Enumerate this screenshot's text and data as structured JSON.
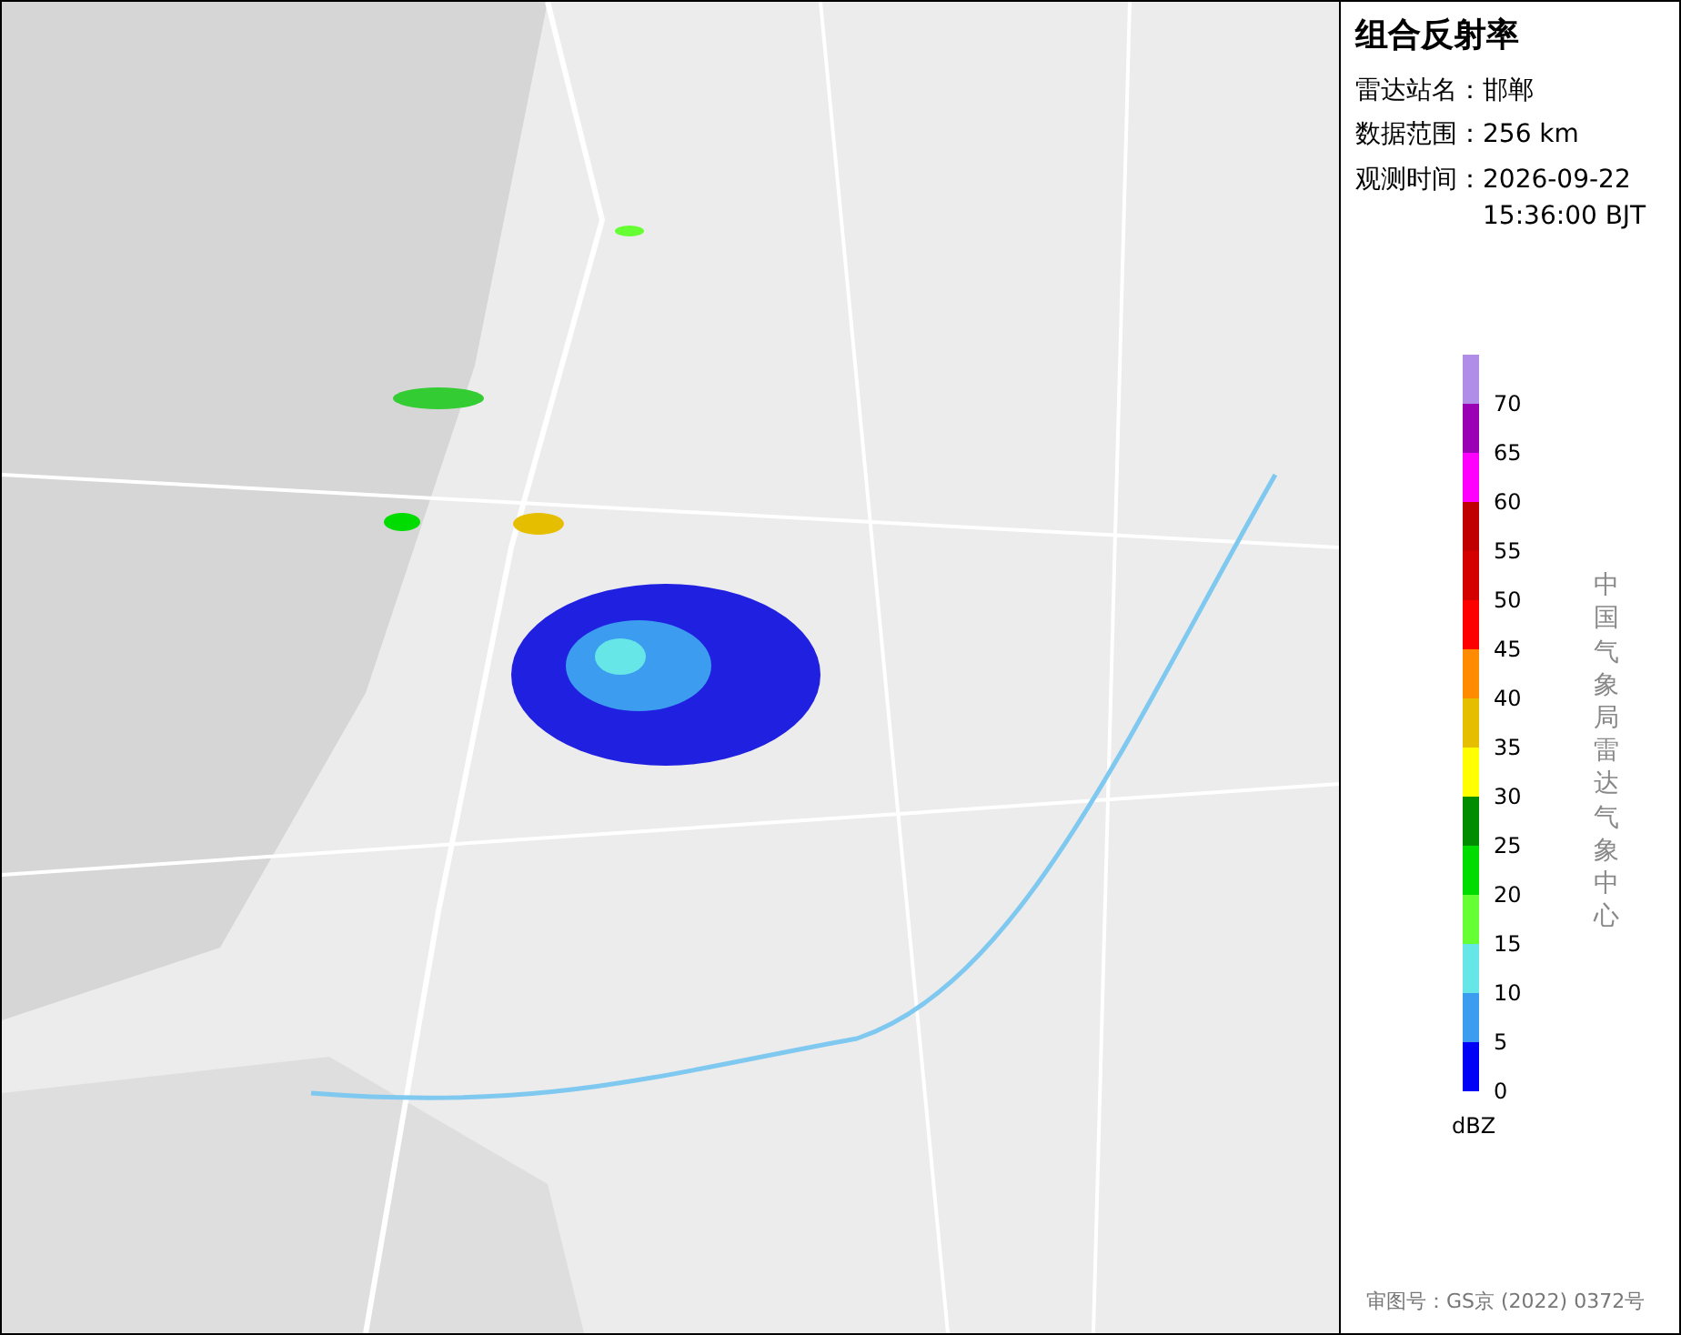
{
  "panel": {
    "title": "组合反射率",
    "info": [
      {
        "label": "雷达站名：",
        "value": "邯郸"
      },
      {
        "label": "数据范围：",
        "value": "256 km"
      },
      {
        "label": "观测时间：",
        "value": "2026-09-22 15:36:00 BJT"
      }
    ],
    "legend": {
      "unit": "dBZ",
      "bands": [
        {
          "color": "#b08ee8",
          "label": "70"
        },
        {
          "color": "#9a00b4",
          "label": "65"
        },
        {
          "color": "#ff00ff",
          "label": "60"
        },
        {
          "color": "#c00000",
          "label": "55"
        },
        {
          "color": "#d40000",
          "label": "50"
        },
        {
          "color": "#ff0000",
          "label": "45"
        },
        {
          "color": "#ff8c00",
          "label": "40"
        },
        {
          "color": "#e6be00",
          "label": "35"
        },
        {
          "color": "#ffff00",
          "label": "30"
        },
        {
          "color": "#008c00",
          "label": "25"
        },
        {
          "color": "#00dc00",
          "label": "20"
        },
        {
          "color": "#66ff33",
          "label": "15"
        },
        {
          "color": "#66e6e6",
          "label": "10"
        },
        {
          "color": "#3c9cf0",
          "label": "5"
        },
        {
          "color": "#0000f6",
          "label": "0"
        }
      ]
    },
    "credit": "中国气象局雷达气象中心",
    "approval": "审图号：GS京 (2022) 0372号"
  }
}
